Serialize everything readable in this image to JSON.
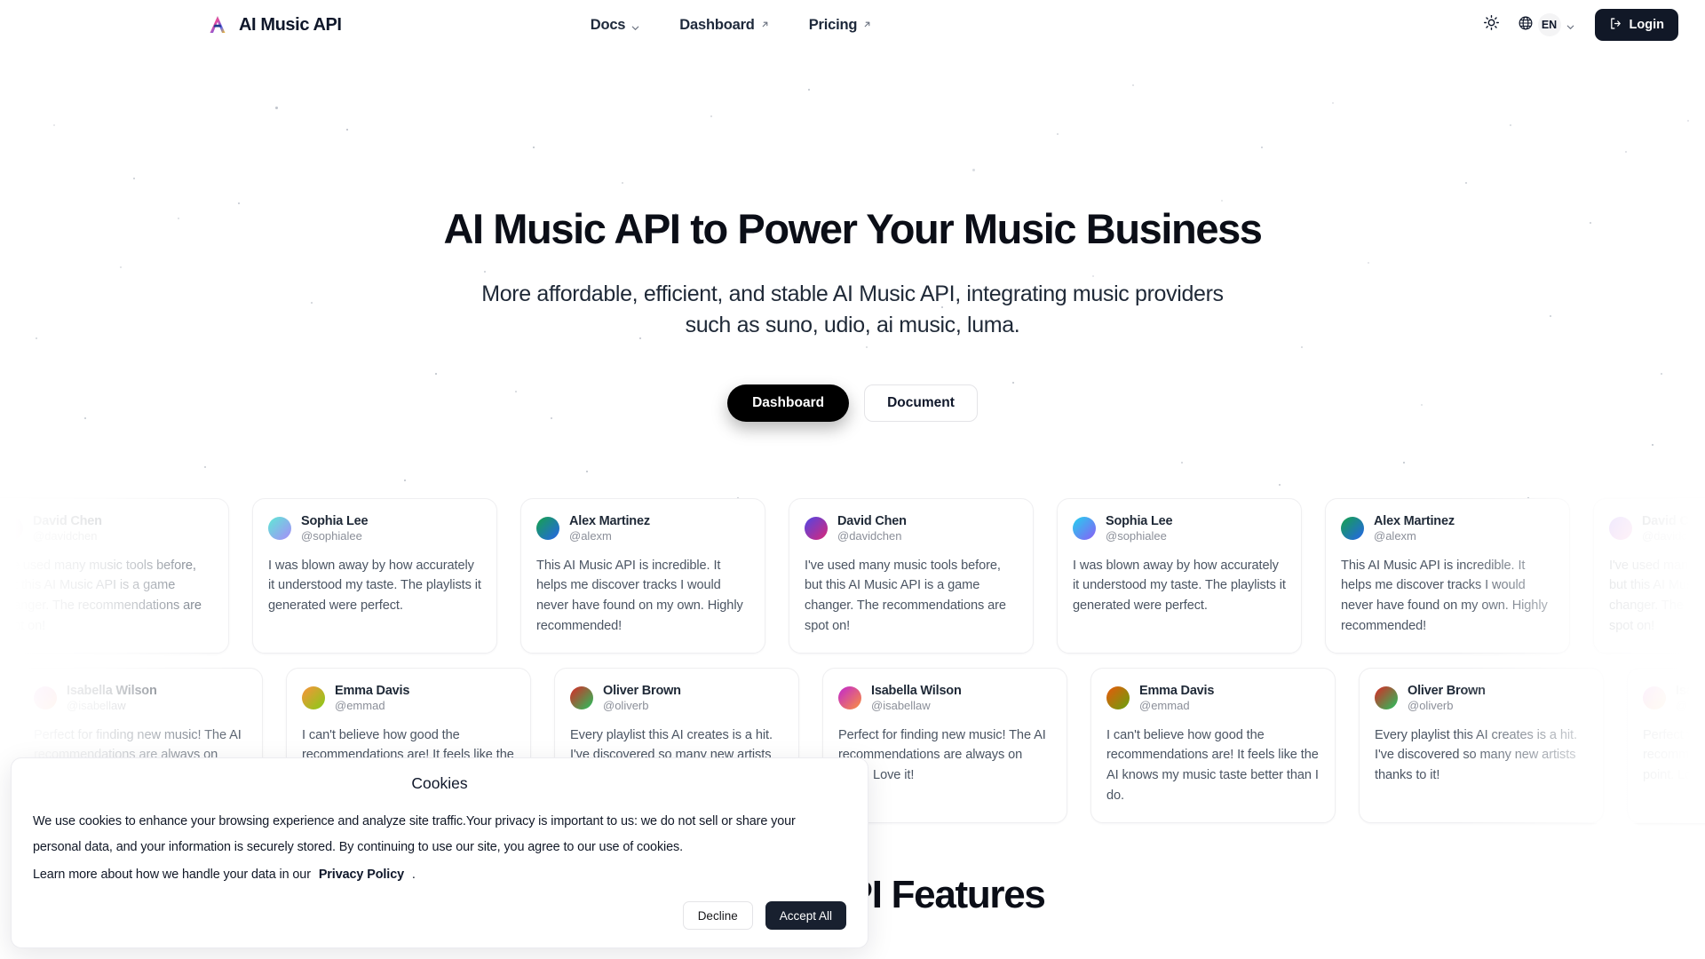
{
  "header": {
    "brand": {
      "name": "AI Music API",
      "logo_icon": "ai-music-logo-icon"
    },
    "nav": [
      {
        "label": "Docs",
        "icon": "chevron-down-icon"
      },
      {
        "label": "Dashboard",
        "icon": "external-link-icon"
      },
      {
        "label": "Pricing",
        "icon": "external-link-icon"
      }
    ],
    "theme_toggle_icon": "sun-icon",
    "language": {
      "globe_icon": "globe-icon",
      "code": "EN",
      "chevron_icon": "chevron-down-icon"
    },
    "login": {
      "label": "Login",
      "icon": "login-icon"
    }
  },
  "hero": {
    "title": "AI Music API to Power Your Music Business",
    "subtitle": "More affordable, efficient, and stable AI Music API, integrating music providers such as suno, udio, ai music, luma.",
    "primary_cta": "Dashboard",
    "secondary_cta": "Document"
  },
  "testimonials": {
    "row1": [
      {
        "name": "David Chen",
        "handle": "@davidchen",
        "text": "I've used many music tools before, but this AI Music API is a game changer. The recommendations are spot on!",
        "avatar_from": "#7c3aed",
        "avatar_to": "#ec4899"
      },
      {
        "name": "Sophia Lee",
        "handle": "@sophialee",
        "text": "I was blown away by how accurately it understood my taste. The playlists it generated were perfect.",
        "avatar_from": "#5eead4",
        "avatar_to": "#a78bfa"
      },
      {
        "name": "Alex Martinez",
        "handle": "@alexm",
        "text": "This AI Music API is incredible. It helps me discover tracks I would never have found on my own. Highly recommended!",
        "avatar_from": "#16a34a",
        "avatar_to": "#2563eb"
      },
      {
        "name": "David Chen",
        "handle": "@davidchen",
        "text": "I've used many music tools before, but this AI Music API is a game changer. The recommendations are spot on!",
        "avatar_from": "#4f46e5",
        "avatar_to": "#db2777"
      },
      {
        "name": "Sophia Lee",
        "handle": "@sophialee",
        "text": "I was blown away by how accurately it understood my taste. The playlists it generated were perfect.",
        "avatar_from": "#22d3ee",
        "avatar_to": "#8b5cf6"
      },
      {
        "name": "Alex Martinez",
        "handle": "@alexm",
        "text": "This AI Music API is incredible. It helps me discover tracks I would never have found on my own. Highly recommended!",
        "avatar_from": "#16a34a",
        "avatar_to": "#2563eb"
      },
      {
        "name": "David Chen",
        "handle": "@davidchen",
        "text": "I've used many music tools before, but this AI Music API is a game changer. The recommendations are spot on!",
        "avatar_from": "#8b5cf6",
        "avatar_to": "#f472b6"
      }
    ],
    "row2": [
      {
        "name": "Isabella Wilson",
        "handle": "@isabellaw",
        "text": "Perfect for finding new music! The AI recommendations are always on point. Love it!",
        "avatar_from": "#c026d3",
        "avatar_to": "#fb923c"
      },
      {
        "name": "Emma Davis",
        "handle": "@emmad",
        "text": "I can't believe how good the recommendations are! It feels like the AI knows my music taste better than I do.",
        "avatar_from": "#fb923c",
        "avatar_to": "#84cc16"
      },
      {
        "name": "Oliver Brown",
        "handle": "@oliverb",
        "text": "Every playlist this AI creates is a hit. I've discovered so many new artists thanks to it!",
        "avatar_from": "#dc2626",
        "avatar_to": "#22c55e"
      },
      {
        "name": "Isabella Wilson",
        "handle": "@isabellaw",
        "text": "Perfect for finding new music! The AI recommendations are always on point. Love it!",
        "avatar_from": "#c026d3",
        "avatar_to": "#fb923c"
      },
      {
        "name": "Emma Davis",
        "handle": "@emmad",
        "text": "I can't believe how good the recommendations are! It feels like the AI knows my music taste better than I do.",
        "avatar_from": "#ea580c",
        "avatar_to": "#65a30d"
      },
      {
        "name": "Oliver Brown",
        "handle": "@oliverb",
        "text": "Every playlist this AI creates is a hit. I've discovered so many new artists thanks to it!",
        "avatar_from": "#dc2626",
        "avatar_to": "#22c55e"
      },
      {
        "name": "Isabella Wilson",
        "handle": "@isabellaw",
        "text": "Perfect for finding new music! The AI recommendations are always on point. Love it!",
        "avatar_from": "#d946ef",
        "avatar_to": "#f59e0b"
      }
    ]
  },
  "features": {
    "heading": "AI Music API Features"
  },
  "cookies": {
    "title": "Cookies",
    "body_line1": "We use cookies to enhance your browsing experience and analyze site traffic.Your privacy is important to us: we do not sell or share your personal data,",
    "body_line2": "and your information is securely stored. By continuing to use our site, you agree to our use of cookies.",
    "learn_prefix": "Learn more about how we handle your data in our",
    "privacy_link": "Privacy Policy",
    "learn_suffix": ".",
    "decline": "Decline",
    "accept": "Accept All"
  },
  "colors": {
    "accent_dark": "#111827",
    "cookie_accept": "#18202f",
    "text": "#0f172a"
  }
}
